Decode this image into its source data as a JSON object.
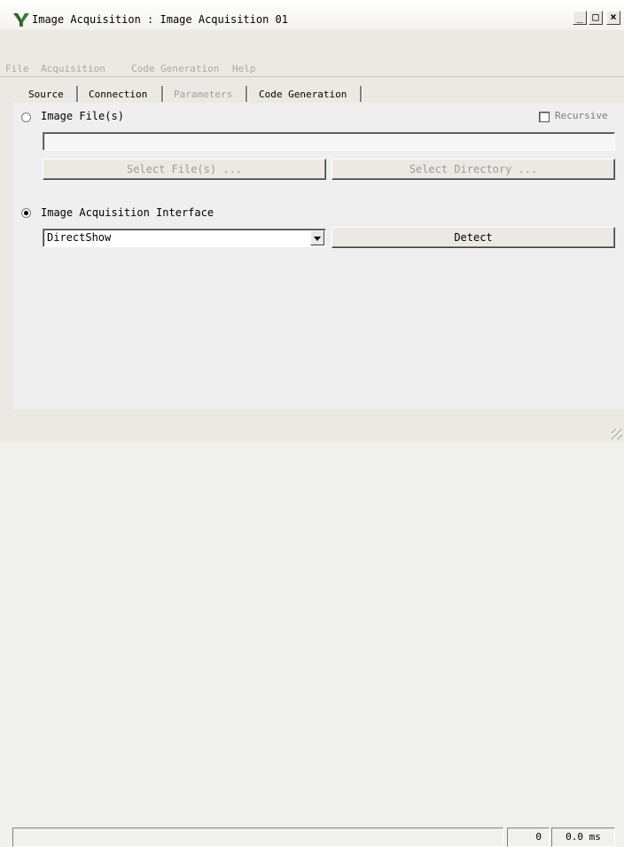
{
  "window": {
    "title": "Image Acquisition : Image Acquisition 01",
    "controls": {
      "minimize": "_",
      "maximize": "□",
      "close": "×"
    }
  },
  "menu": [
    "File",
    "Acquisition",
    "Code Generation",
    "Help"
  ],
  "toolbar": {
    "icons": [
      "open-folder-icon",
      "save-icon",
      "properties-icon",
      "connect-icon",
      "snap-icon",
      "live-icon",
      "help-icon"
    ]
  },
  "tabs": [
    {
      "label": "Source",
      "active": true
    },
    {
      "label": "Connection",
      "active": false
    },
    {
      "label": "Parameters",
      "active": false,
      "disabled": true
    },
    {
      "label": "Code Generation",
      "active": false
    }
  ],
  "source": {
    "image_files_label": "Image File(s)",
    "image_files_selected": false,
    "recursive_label": "Recursive",
    "recursive_checked": false,
    "path_value": "",
    "select_files_label": "Select File(s) ...",
    "select_directory_label": "Select Directory ...",
    "interface_label": "Image Acquisition Interface",
    "interface_selected": true,
    "interface_value": "DirectShow",
    "detect_label": "Detect"
  },
  "status": {
    "message": "",
    "count": "0",
    "time": "0.0 ms"
  }
}
